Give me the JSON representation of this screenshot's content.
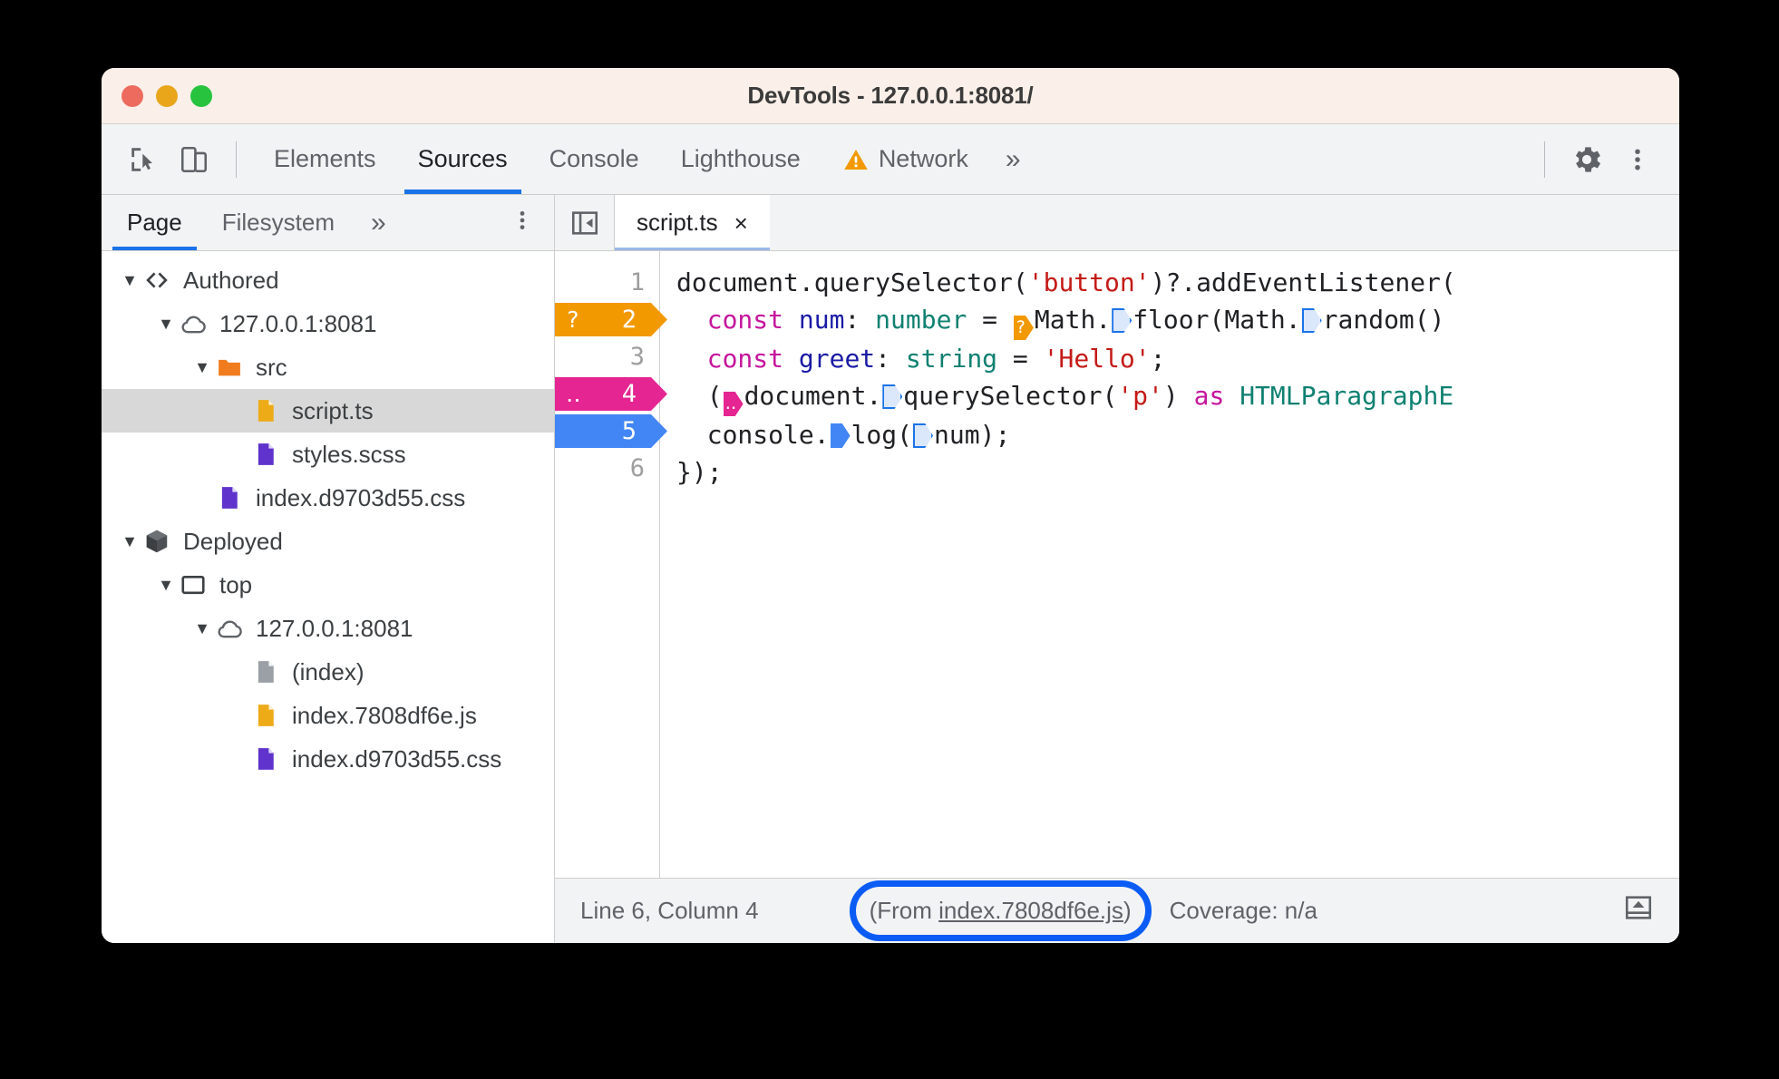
{
  "window": {
    "title": "DevTools - 127.0.0.1:8081/",
    "traffic_lights": [
      "close",
      "minimize",
      "maximize"
    ],
    "colors": {
      "accent": "#1a73e8",
      "titlebar_bg": "#faf0e9",
      "toolbar_bg": "#f1f3f4",
      "highlight_ring": "#0b5cf5",
      "warning": "#f29900",
      "logpoint": "#e52592",
      "breakpoint": "#4285f4"
    }
  },
  "toolbar": {
    "inspect_icon": "inspect-element-icon",
    "device_icon": "device-toolbar-icon",
    "tabs": [
      {
        "label": "Elements",
        "active": false,
        "warning": false
      },
      {
        "label": "Sources",
        "active": true,
        "warning": false
      },
      {
        "label": "Console",
        "active": false,
        "warning": false
      },
      {
        "label": "Lighthouse",
        "active": false,
        "warning": false
      },
      {
        "label": "Network",
        "active": false,
        "warning": true
      }
    ],
    "more_tabs": "»",
    "settings_icon": "gear-icon",
    "menu_icon": "kebab-menu-icon"
  },
  "navigator": {
    "tabs": [
      {
        "label": "Page",
        "active": true
      },
      {
        "label": "Filesystem",
        "active": false
      }
    ],
    "more": "»",
    "kebab": "kebab-menu-icon",
    "tree": [
      {
        "label": "Authored",
        "depth": 0,
        "icon": "code-brackets-icon",
        "twisty": "open",
        "selected": false
      },
      {
        "label": "127.0.0.1:8081",
        "depth": 1,
        "icon": "cloud-icon",
        "twisty": "open",
        "selected": false
      },
      {
        "label": "src",
        "depth": 2,
        "icon": "folder-icon",
        "twisty": "open",
        "selected": false
      },
      {
        "label": "script.ts",
        "depth": 3,
        "icon": "file-ts-icon",
        "twisty": "none",
        "selected": true
      },
      {
        "label": "styles.scss",
        "depth": 3,
        "icon": "file-css-icon",
        "twisty": "none",
        "selected": false
      },
      {
        "label": "index.d9703d55.css",
        "depth": 2,
        "icon": "file-css-icon",
        "twisty": "none",
        "selected": false
      },
      {
        "label": "Deployed",
        "depth": 0,
        "icon": "cube-icon",
        "twisty": "open",
        "selected": false
      },
      {
        "label": "top",
        "depth": 1,
        "icon": "frame-icon",
        "twisty": "open",
        "selected": false
      },
      {
        "label": "127.0.0.1:8081",
        "depth": 2,
        "icon": "cloud-icon",
        "twisty": "open",
        "selected": false
      },
      {
        "label": "(index)",
        "depth": 3,
        "icon": "file-doc-icon",
        "twisty": "none",
        "selected": false
      },
      {
        "label": "index.7808df6e.js",
        "depth": 3,
        "icon": "file-js-icon",
        "twisty": "none",
        "selected": false
      },
      {
        "label": "index.d9703d55.css",
        "depth": 3,
        "icon": "file-css-icon",
        "twisty": "none",
        "selected": false
      }
    ]
  },
  "editor": {
    "collapse_icon": "collapse-sidebar-icon",
    "open_tab": {
      "label": "script.ts",
      "close": "×"
    },
    "gutter": [
      {
        "number": "1",
        "breakpoint": "none"
      },
      {
        "number": "2",
        "breakpoint": "conditional",
        "mark": "?"
      },
      {
        "number": "3",
        "breakpoint": "none"
      },
      {
        "number": "4",
        "breakpoint": "logpoint",
        "mark": "‥"
      },
      {
        "number": "5",
        "breakpoint": "normal",
        "mark": ""
      },
      {
        "number": "6",
        "breakpoint": "none"
      }
    ],
    "code_lines": [
      "document.querySelector('button')?.addEventListener(",
      "  const num: number = Math.floor(Math.random()",
      "  const greet: string = 'Hello';",
      "  (document.querySelector('p') as HTMLParagraphE",
      "  console.log(num);",
      "});"
    ]
  },
  "statusbar": {
    "cursor": "Line 6, Column 4",
    "from_prefix": "(From ",
    "from_link": "index.7808df6e.js",
    "from_suffix": ")",
    "coverage": "Coverage: n/a",
    "drawer_icon": "show-drawer-icon"
  }
}
